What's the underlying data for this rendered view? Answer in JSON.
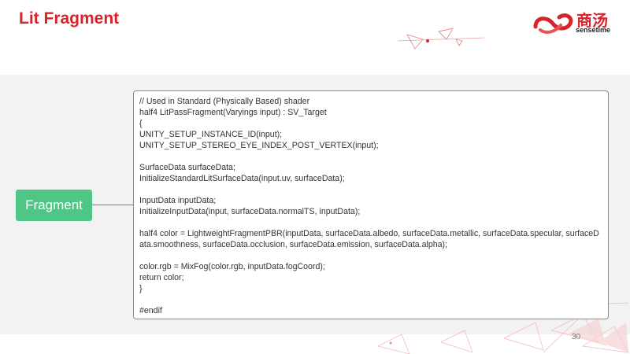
{
  "slide": {
    "title": "Lit Fragment",
    "page_number": "30"
  },
  "brand": {
    "name_cn": "商汤",
    "name_en": "sensetime",
    "color": "#d8232a"
  },
  "label": {
    "text": "Fragment",
    "color": "#4fc685"
  },
  "code": {
    "lines": [
      "// Used in Standard (Physically Based) shader",
      "half4 LitPassFragment(Varyings input) : SV_Target",
      "{",
      "UNITY_SETUP_INSTANCE_ID(input);",
      "UNITY_SETUP_STEREO_EYE_INDEX_POST_VERTEX(input);",
      "",
      "SurfaceData surfaceData;",
      "InitializeStandardLitSurfaceData(input.uv, surfaceData);",
      "",
      "InputData inputData;",
      "InitializeInputData(input, surfaceData.normalTS, inputData);",
      "",
      "half4 color = LightweightFragmentPBR(inputData, surfaceData.albedo, surfaceData.metallic, surfaceData.specular, surfaceD",
      "ata.smoothness, surfaceData.occlusion, surfaceData.emission, surfaceData.alpha);",
      "",
      "color.rgb = MixFog(color.rgb, inputData.fogCoord);",
      "return color;",
      "}",
      "",
      "#endif"
    ]
  }
}
